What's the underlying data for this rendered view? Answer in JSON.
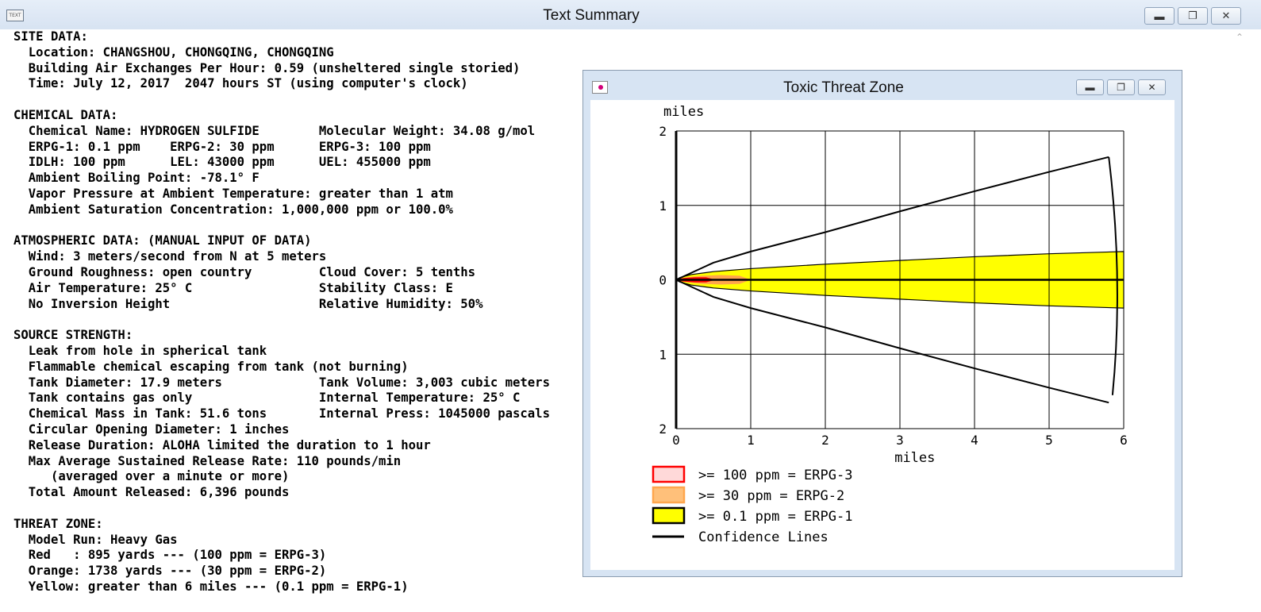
{
  "window": {
    "title": "Text Summary",
    "app_icon_text": "TEXT"
  },
  "summary_lines": [
    "SITE DATA:",
    "  Location: CHANGSHOU, CHONGQING, CHONGQING",
    "  Building Air Exchanges Per Hour: 0.59 (unsheltered single storied)",
    "  Time: July 12, 2017  2047 hours ST (using computer's clock)",
    "",
    "CHEMICAL DATA:",
    "  Chemical Name: HYDROGEN SULFIDE        Molecular Weight: 34.08 g/mol",
    "  ERPG-1: 0.1 ppm    ERPG-2: 30 ppm      ERPG-3: 100 ppm",
    "  IDLH: 100 ppm      LEL: 43000 ppm      UEL: 455000 ppm",
    "  Ambient Boiling Point: -78.1° F",
    "  Vapor Pressure at Ambient Temperature: greater than 1 atm",
    "  Ambient Saturation Concentration: 1,000,000 ppm or 100.0%",
    "",
    "ATMOSPHERIC DATA: (MANUAL INPUT OF DATA)",
    "  Wind: 3 meters/second from N at 5 meters",
    "  Ground Roughness: open country         Cloud Cover: 5 tenths",
    "  Air Temperature: 25° C                 Stability Class: E",
    "  No Inversion Height                    Relative Humidity: 50%",
    "",
    "SOURCE STRENGTH:",
    "  Leak from hole in spherical tank",
    "  Flammable chemical escaping from tank (not burning)",
    "  Tank Diameter: 17.9 meters             Tank Volume: 3,003 cubic meters",
    "  Tank contains gas only                 Internal Temperature: 25° C",
    "  Chemical Mass in Tank: 51.6 tons       Internal Press: 1045000 pascals",
    "  Circular Opening Diameter: 1 inches",
    "  Release Duration: ALOHA limited the duration to 1 hour",
    "  Max Average Sustained Release Rate: 110 pounds/min",
    "     (averaged over a minute or more)",
    "  Total Amount Released: 6,396 pounds",
    "",
    "THREAT ZONE:",
    "  Model Run: Heavy Gas",
    "  Red   : 895 yards --- (100 ppm = ERPG-3)",
    "  Orange: 1738 yards --- (30 ppm = ERPG-2)",
    "  Yellow: greater than 6 miles --- (0.1 ppm = ERPG-1)"
  ],
  "threat_window": {
    "title": "Toxic Threat Zone"
  },
  "chart_data": {
    "type": "area",
    "xlabel": "miles",
    "ylabel": "miles",
    "xlim": [
      0,
      6
    ],
    "ylim": [
      -2,
      2
    ],
    "x_ticks": [
      "0",
      "1",
      "2",
      "3",
      "4",
      "5",
      "6"
    ],
    "y_ticks": [
      "2",
      "1",
      "0",
      "1",
      "2"
    ],
    "grid": true,
    "colors": {
      "red": "#ff0000",
      "orange": "#ffa64d",
      "yellow": "#ffff00",
      "confidence": "#000000"
    },
    "zones": [
      {
        "name": "red",
        "max_x": 0.51,
        "upper": [
          [
            0,
            0
          ],
          [
            0.1,
            0.02
          ],
          [
            0.25,
            0.03
          ],
          [
            0.4,
            0.03
          ],
          [
            0.51,
            0.0
          ]
        ]
      },
      {
        "name": "orange",
        "max_x": 0.99,
        "upper": [
          [
            0,
            0
          ],
          [
            0.15,
            0.03
          ],
          [
            0.35,
            0.05
          ],
          [
            0.6,
            0.06
          ],
          [
            0.85,
            0.05
          ],
          [
            0.99,
            0.0
          ]
        ]
      },
      {
        "name": "yellow",
        "max_x": 6.0,
        "upper": [
          [
            0,
            0
          ],
          [
            0.05,
            0.03
          ],
          [
            0.2,
            0.07
          ],
          [
            0.5,
            0.11
          ],
          [
            1.0,
            0.15
          ],
          [
            2.0,
            0.21
          ],
          [
            3.0,
            0.26
          ],
          [
            4.0,
            0.31
          ],
          [
            5.0,
            0.35
          ],
          [
            6.0,
            0.38
          ]
        ]
      }
    ],
    "confidence_upper": [
      [
        0,
        0
      ],
      [
        0.5,
        0.23
      ],
      [
        1.0,
        0.38
      ],
      [
        2.0,
        0.64
      ],
      [
        3.0,
        0.92
      ],
      [
        4.0,
        1.19
      ],
      [
        5.0,
        1.45
      ],
      [
        5.8,
        1.65
      ]
    ],
    "confidence_arc_end_x": 5.85,
    "legend": [
      {
        "label": ">= 100 ppm = ERPG-3",
        "type": "red"
      },
      {
        "label": ">= 30 ppm = ERPG-2",
        "type": "orange"
      },
      {
        "label": ">= 0.1 ppm = ERPG-1",
        "type": "yellow"
      },
      {
        "label": "Confidence Lines",
        "type": "line"
      }
    ]
  }
}
